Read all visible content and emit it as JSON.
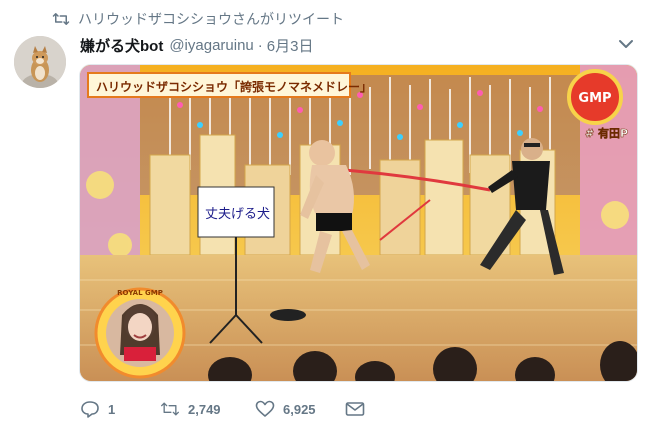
{
  "retweet_line": {
    "text": "ハリウッドザコシショウさんがリツイート",
    "icon": "retweet-icon"
  },
  "tweet": {
    "display_name": "嫌がる犬bot",
    "handle": "@iyagaruinu",
    "separator": "·",
    "date": "6月3日"
  },
  "media": {
    "caption": "ハリウッドザコシショウ「誇張モノマネメドレー」",
    "whiteboard_text": "丈夫げる犬",
    "show_logo": "GMP",
    "hashtag": "# 有田P",
    "inset_ring_text": "ROYAL GMP"
  },
  "actions": {
    "reply_count": "1",
    "retweet_count": "2,749",
    "like_count": "6,925"
  },
  "colors": {
    "muted": "#657786",
    "text": "#14171a",
    "border": "#e1e8ed",
    "stage_yellow": "#f2c83a",
    "rope_red": "#e0393e"
  }
}
